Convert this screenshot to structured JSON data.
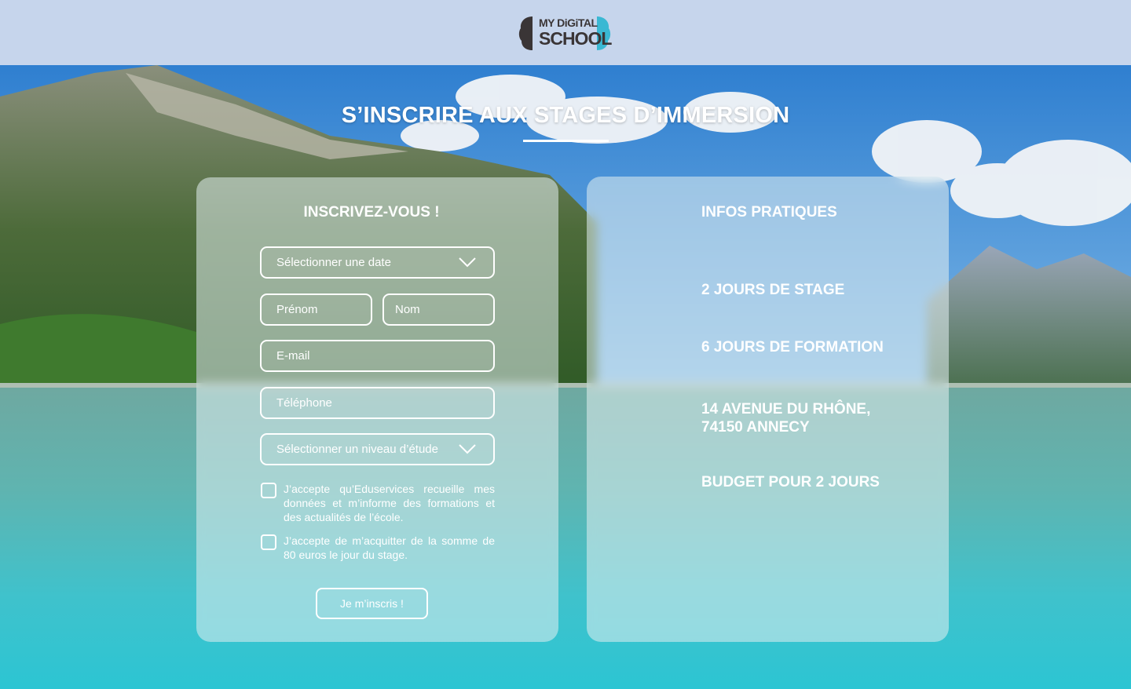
{
  "brand": {
    "logo_text_top": "MY DiGiTAL",
    "logo_text_bottom": "SCHOOL",
    "logo_colors": {
      "dark": "#3a3536",
      "accent": "#3ab8d3"
    }
  },
  "page": {
    "title": "S’INSCRIRE AUX STAGES D’IMMERSION"
  },
  "form": {
    "heading": "INSCRIVEZ-VOUS !",
    "date_select": "Sélectionner une date",
    "firstname_placeholder": "Prénom",
    "lastname_placeholder": "Nom",
    "email_placeholder": "E-mail",
    "phone_placeholder": "Téléphone",
    "level_select": "Sélectionner un niveau d’étude",
    "consent_data": "J’accepte qu’Eduservices recueille mes données et m’informe des formations et des actualités de l’école.",
    "consent_payment": "J’accepte de m’acquitter de la somme de 80 euros le jour du stage.",
    "submit_label": "Je m’inscris !"
  },
  "infos": {
    "heading": "INFOS PRATIQUES",
    "items": [
      "2 JOURS DE STAGE",
      "6 JOURS DE FORMATION",
      "14 AVENUE DU RHÔNE,",
      "74150 ANNECY",
      "BUDGET POUR 2 JOURS"
    ]
  },
  "colors": {
    "header_bg": "#c6d5ec",
    "water": "#2cc5d3",
    "text": "#ffffff"
  }
}
